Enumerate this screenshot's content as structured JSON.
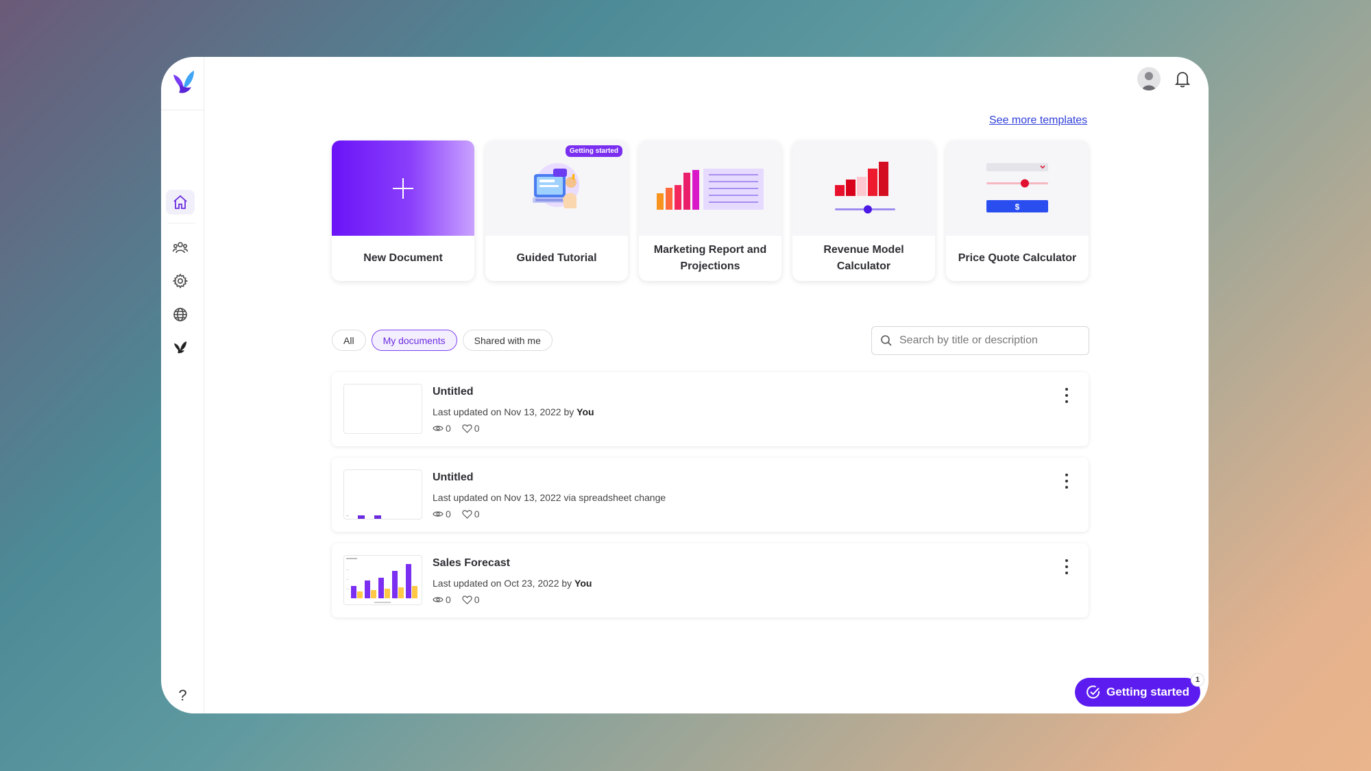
{
  "header": {
    "see_more_templates": "See more templates"
  },
  "templates": [
    {
      "label": "New Document"
    },
    {
      "label": "Guided Tutorial",
      "badge": "Getting started"
    },
    {
      "label": "Marketing Report and Projections"
    },
    {
      "label": "Revenue Model Calculator"
    },
    {
      "label": "Price Quote Calculator"
    }
  ],
  "filters": {
    "all": "All",
    "mine": "My documents",
    "shared": "Shared with me",
    "active": "My documents"
  },
  "search": {
    "placeholder": "Search by title or description"
  },
  "documents": [
    {
      "title": "Untitled",
      "meta_prefix": "Last updated on Nov 13, 2022 by ",
      "meta_user": "You",
      "views": "0",
      "likes": "0"
    },
    {
      "title": "Untitled",
      "meta_prefix": "Last updated on Nov 13, 2022 via spreadsheet change",
      "meta_user": "",
      "views": "0",
      "likes": "0"
    },
    {
      "title": "Sales Forecast",
      "meta_prefix": "Last updated on Oct 23, 2022 by ",
      "meta_user": "You",
      "views": "0",
      "likes": "0"
    }
  ],
  "getting_started": {
    "label": "Getting started",
    "count": "1"
  },
  "help_label": "?",
  "colors": {
    "accent": "#5c1cf0",
    "link": "#2f3ed8"
  }
}
